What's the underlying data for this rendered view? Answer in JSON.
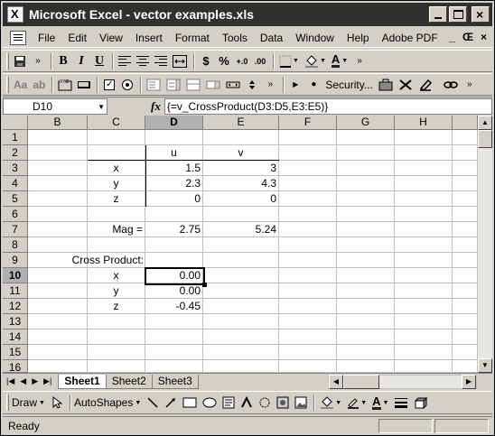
{
  "window": {
    "title": "Microsoft Excel - vector examples.xls"
  },
  "menu": {
    "items": [
      "File",
      "Edit",
      "View",
      "Insert",
      "Format",
      "Tools",
      "Data",
      "Window",
      "Help",
      "Adobe PDF"
    ],
    "doc_controls": [
      "_",
      "Œ",
      "×"
    ]
  },
  "toolbar1": {
    "bold": "B",
    "italic": "I",
    "underline": "U",
    "currency": "$",
    "percent": "%",
    "inc_decimal": "+.0",
    "dec_decimal": ".00",
    "font_color_letter": "A"
  },
  "toolbar2": {
    "label_btn": "Aa",
    "textbox_btn": "ab",
    "security": "Security..."
  },
  "formula_bar": {
    "name_box": "D10",
    "fx": "fx",
    "formula": "{=v_CrossProduct(D3:D5,E3:E5)}"
  },
  "grid": {
    "columns": [
      "B",
      "C",
      "D",
      "E",
      "F",
      "G",
      "H"
    ],
    "selected_column": "D",
    "rows": [
      "1",
      "2",
      "3",
      "4",
      "5",
      "6",
      "7",
      "8",
      "9",
      "10",
      "11",
      "12",
      "13",
      "14",
      "15",
      "16"
    ],
    "selected_row": "10",
    "cells": {
      "D2": "u",
      "E2": "v",
      "C3": "x",
      "D3": "1.5",
      "E3": "3",
      "C4": "y",
      "D4": "2.3",
      "E4": "4.3",
      "C5": "z",
      "D5": "0",
      "E5": "0",
      "C7": "Mag =",
      "D7": "2.75",
      "E7": "5.24",
      "C9": "Cross Product:",
      "C10": "x",
      "D10": "0.00",
      "C11": "y",
      "D11": "0.00",
      "C12": "z",
      "D12": "-0.45"
    }
  },
  "sheets": {
    "tabs": [
      "Sheet1",
      "Sheet2",
      "Sheet3"
    ],
    "active": "Sheet1"
  },
  "drawing": {
    "draw": "Draw",
    "autoshapes": "AutoShapes"
  },
  "status": {
    "text": "Ready"
  }
}
